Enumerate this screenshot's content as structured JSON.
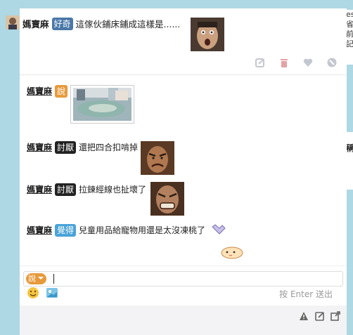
{
  "post": {
    "username": "媽寶麻",
    "badge": "好奇",
    "text": "這傢伙鋪床鋪成這樣是......"
  },
  "side": {
    "lines": [
      "es",
      "省",
      "前",
      "記"
    ],
    "label": "稱"
  },
  "messages": [
    {
      "user": "媽寶麻",
      "badge": "說",
      "badge_color": "#e79a3c",
      "text": ""
    },
    {
      "user": "媽寶麻",
      "badge": "討厭",
      "badge_color": "#222222",
      "text": "還把四合扣啃掉"
    },
    {
      "user": "媽寶麻",
      "badge": "討厭",
      "badge_color": "#222222",
      "text": "拉鍊經線也扯壞了"
    },
    {
      "user": "媽寶麻",
      "badge": "覺得",
      "badge_color": "#4aa3d9",
      "text": "兒童用品給寵物用還是太沒凍桃了"
    }
  ],
  "composer": {
    "mode": "說",
    "hint": "按 Enter 送出"
  },
  "colors": {
    "background": "#aed8e4",
    "badge_curious": "#4a78a8",
    "icon_gray": "#c3c7d0",
    "trash": "#e5a0a4"
  }
}
